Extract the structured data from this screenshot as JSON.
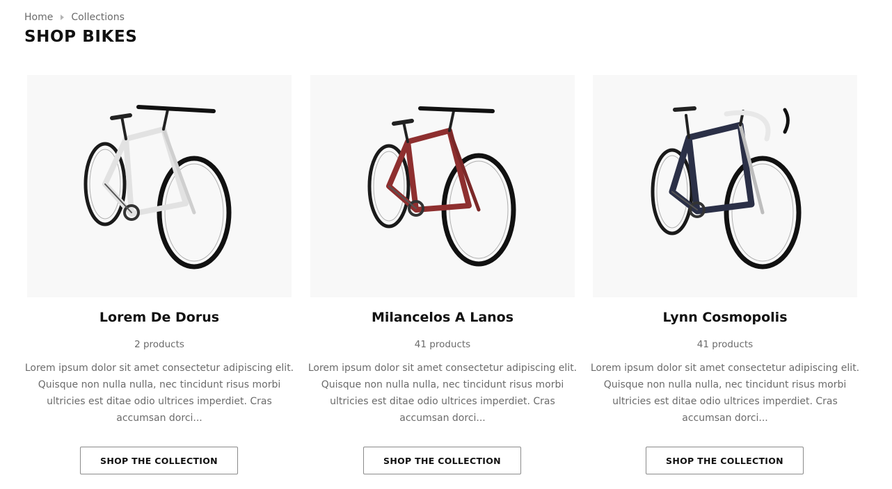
{
  "breadcrumb": {
    "home": "Home",
    "current": "Collections"
  },
  "page_title": "SHOP BIKES",
  "collections": [
    {
      "title": "Lorem De Dorus",
      "count": "2 products",
      "description": "Lorem ipsum dolor sit amet consectetur adipiscing elit. Quisque non nulla nulla, nec tincidunt risus morbi ultricies est ditae odio ultrices imperdiet. Cras accumsan dorci...",
      "button": "SHOP THE COLLECTION",
      "frame_color": "#e2e2e2",
      "image_icon": "white-road-bike"
    },
    {
      "title": "Milancelos A Lanos",
      "count": "41 products",
      "description": "Lorem ipsum dolor sit amet consectetur adipiscing elit. Quisque non nulla nulla, nec tincidunt risus morbi ultricies est ditae odio ultrices imperdiet. Cras accumsan dorci...",
      "button": "SHOP THE COLLECTION",
      "frame_color": "#8e2f2f",
      "image_icon": "red-road-bike"
    },
    {
      "title": "Lynn Cosmopolis",
      "count": "41 products",
      "description": "Lorem ipsum dolor sit amet consectetur adipiscing elit. Quisque non nulla nulla, nec tincidunt risus morbi ultricies est ditae odio ultrices imperdiet. Cras accumsan dorci...",
      "button": "SHOP THE COLLECTION",
      "frame_color": "#2b3047",
      "image_icon": "navy-road-bike"
    }
  ]
}
